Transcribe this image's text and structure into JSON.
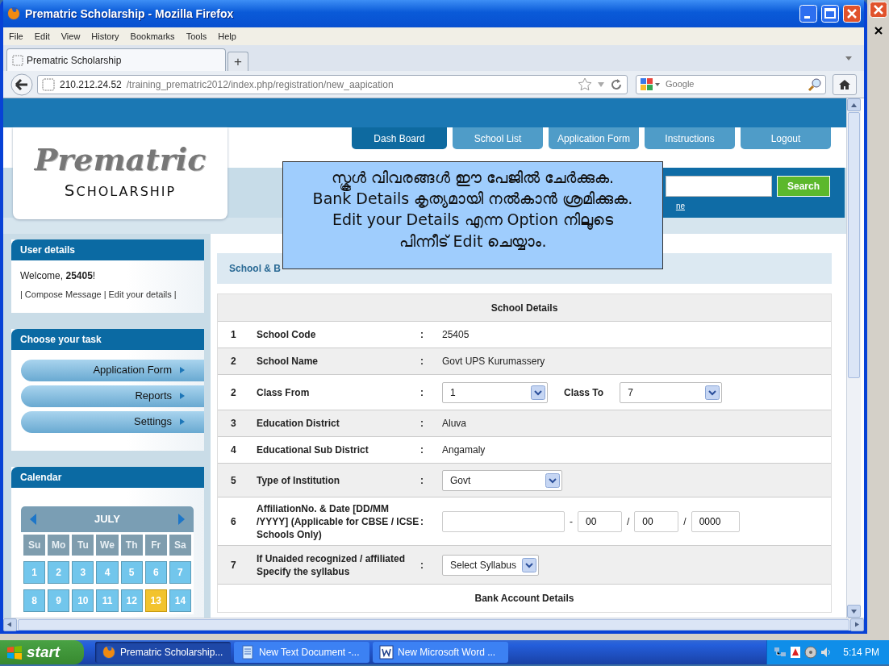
{
  "window": {
    "title": "Prematric Scholarship - Mozilla Firefox"
  },
  "menu": [
    "File",
    "Edit",
    "View",
    "History",
    "Bookmarks",
    "Tools",
    "Help"
  ],
  "tabs": [
    {
      "label": "Prematric Scholarship",
      "selected": true
    }
  ],
  "new_tab": "+",
  "address": {
    "host": "210.212.24.52",
    "path": "/training_prematric2012/index.php/registration/new_aapication"
  },
  "search_engine": {
    "placeholder": "Google"
  },
  "site": {
    "logo": {
      "title": "Prematric",
      "subtitle": "SCHOLARSHIP"
    },
    "nav": [
      {
        "label": "Dash Board",
        "selected": true
      },
      {
        "label": "School List",
        "selected": false
      },
      {
        "label": "Application Form",
        "selected": false
      },
      {
        "label": "Instructions",
        "selected": false
      },
      {
        "label": "Logout",
        "selected": false
      }
    ],
    "search": {
      "button": "Search",
      "link": "ne"
    },
    "notice": [
      "സ്കൂൾ വിവരങ്ങൾ ഈ പേജിൽ ചേർക്കുക.",
      "Bank Details കൃത്യമായി നൽകാൻ ശ്രമിക്കുക.",
      "Edit your Details എന്ന Option നിലൂടെ",
      "പിന്നീട് Edit ചെയ്യാം."
    ],
    "user_details": {
      "title": "User details",
      "welcome": "Welcome, **25405**!",
      "links": [
        "Compose Message",
        "Edit your details"
      ],
      "separators": [
        "|",
        "|",
        "|"
      ]
    },
    "tasks": {
      "title": "Choose your task",
      "items": [
        "Application Form",
        "Reports",
        "Settings"
      ]
    },
    "calendar": {
      "title": "Calendar",
      "month": "JULY",
      "weekdays": [
        "Su",
        "Mo",
        "Tu",
        "We",
        "Th",
        "Fr",
        "Sa"
      ],
      "days": [
        {
          "label": "1",
          "selected": false
        },
        {
          "label": "2",
          "selected": false
        },
        {
          "label": "3",
          "selected": false
        },
        {
          "label": "4",
          "selected": false
        },
        {
          "label": "5",
          "selected": false
        },
        {
          "label": "6",
          "selected": false
        },
        {
          "label": "7",
          "selected": false
        },
        {
          "label": "8",
          "selected": false
        },
        {
          "label": "9",
          "selected": false
        },
        {
          "label": "10",
          "selected": false
        },
        {
          "label": "11",
          "selected": false
        },
        {
          "label": "12",
          "selected": false
        },
        {
          "label": "13",
          "selected": true
        },
        {
          "label": "14",
          "selected": false
        }
      ]
    },
    "section": {
      "heading": "School & B",
      "table_title": "School Details",
      "rows": [
        {
          "kind": "text",
          "number": "1",
          "label": "School Code",
          "colon": ":",
          "value": "25405"
        },
        {
          "kind": "text",
          "number": "2",
          "label": "School Name",
          "colon": ":",
          "value": "Govt UPS Kurumassery"
        },
        {
          "kind": "range",
          "number": "2",
          "label": "Class From",
          "colon": ":",
          "value": "1",
          "to_label": "Class To",
          "to_value": "7"
        },
        {
          "kind": "text",
          "number": "3",
          "label": "Education District",
          "colon": ":",
          "value": "Aluva"
        },
        {
          "kind": "text",
          "number": "4",
          "label": "Educational Sub District",
          "colon": ":",
          "value": "Angamaly"
        },
        {
          "kind": "select",
          "number": "5",
          "label": "Type of Institution",
          "colon": ":",
          "value": "Govt"
        },
        {
          "kind": "affiliation",
          "number": "6",
          "label": "AffiliationNo. & Date [DD/MM /YYYY] (Applicable for CBSE / ICSE Schools Only)",
          "colon": ":",
          "separators": [
            "-",
            "/",
            "/"
          ],
          "day": "00",
          "month": "00",
          "year": "0000"
        },
        {
          "kind": "select",
          "number": "7",
          "label": "If Unaided recognized / affiliated Specify the syllabus",
          "colon": ":",
          "value": "Select Syllabus"
        }
      ],
      "next_title": "Bank Account Details"
    }
  },
  "taskbar": {
    "start": "start",
    "tasks": [
      {
        "kind": "firefox",
        "label": "Prematric Scholarship...",
        "selected": true
      },
      {
        "kind": "notepad",
        "label": "New Text Document -...",
        "selected": false
      },
      {
        "kind": "word",
        "label": "New Microsoft Word ...",
        "selected": false
      }
    ],
    "clock": "5:14 PM"
  }
}
